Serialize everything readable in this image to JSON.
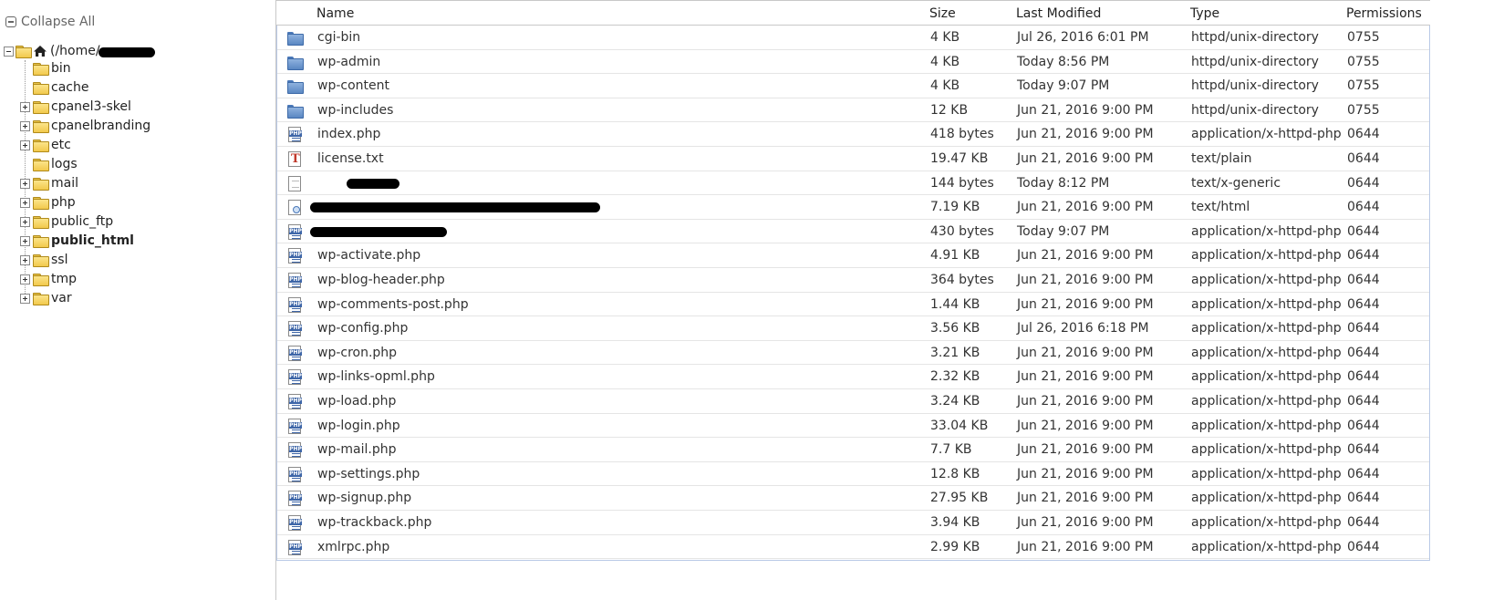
{
  "tree": {
    "collapse_all_label": "Collapse All",
    "root_label": "(/home/",
    "items": [
      {
        "label": "bin",
        "expandable": false,
        "bold": false
      },
      {
        "label": "cache",
        "expandable": false,
        "bold": false
      },
      {
        "label": "cpanel3-skel",
        "expandable": true,
        "bold": false
      },
      {
        "label": "cpanelbranding",
        "expandable": true,
        "bold": false
      },
      {
        "label": "etc",
        "expandable": true,
        "bold": false
      },
      {
        "label": "logs",
        "expandable": false,
        "bold": false
      },
      {
        "label": "mail",
        "expandable": true,
        "bold": false
      },
      {
        "label": "php",
        "expandable": true,
        "bold": false
      },
      {
        "label": "public_ftp",
        "expandable": true,
        "bold": false
      },
      {
        "label": "public_html",
        "expandable": true,
        "bold": true
      },
      {
        "label": "ssl",
        "expandable": true,
        "bold": false
      },
      {
        "label": "tmp",
        "expandable": true,
        "bold": false
      },
      {
        "label": "var",
        "expandable": true,
        "bold": false
      }
    ]
  },
  "file_table": {
    "columns": {
      "name": "Name",
      "size": "Size",
      "modified": "Last Modified",
      "type": "Type",
      "permissions": "Permissions"
    },
    "rows": [
      {
        "icon": "folder-icon",
        "name": "cgi-bin",
        "size": "4 KB",
        "modified": "Jul 26, 2016 6:01 PM",
        "type": "httpd/unix-directory",
        "perm": "0755"
      },
      {
        "icon": "folder-icon",
        "name": "wp-admin",
        "size": "4 KB",
        "modified": "Today 8:56 PM",
        "type": "httpd/unix-directory",
        "perm": "0755"
      },
      {
        "icon": "folder-icon",
        "name": "wp-content",
        "size": "4 KB",
        "modified": "Today 9:07 PM",
        "type": "httpd/unix-directory",
        "perm": "0755"
      },
      {
        "icon": "folder-icon",
        "name": "wp-includes",
        "size": "12 KB",
        "modified": "Jun 21, 2016 9:00 PM",
        "type": "httpd/unix-directory",
        "perm": "0755"
      },
      {
        "icon": "php-file-icon",
        "name": "index.php",
        "size": "418 bytes",
        "modified": "Jun 21, 2016 9:00 PM",
        "type": "application/x-httpd-php",
        "perm": "0644"
      },
      {
        "icon": "text-file-icon",
        "name": "license.txt",
        "size": "19.47 KB",
        "modified": "Jun 21, 2016 9:00 PM",
        "type": "text/plain",
        "perm": "0644"
      },
      {
        "icon": "generic-file-icon",
        "name": "",
        "redacted": true,
        "size": "144 bytes",
        "modified": "Today 8:12 PM",
        "type": "text/x-generic",
        "perm": "0644"
      },
      {
        "icon": "html-file-icon",
        "name": "",
        "redacted": true,
        "size": "7.19 KB",
        "modified": "Jun 21, 2016 9:00 PM",
        "type": "text/html",
        "perm": "0644"
      },
      {
        "icon": "php-file-icon",
        "name": "",
        "redacted": true,
        "size": "430 bytes",
        "modified": "Today 9:07 PM",
        "type": "application/x-httpd-php",
        "perm": "0644"
      },
      {
        "icon": "php-file-icon",
        "name": "wp-activate.php",
        "size": "4.91 KB",
        "modified": "Jun 21, 2016 9:00 PM",
        "type": "application/x-httpd-php",
        "perm": "0644"
      },
      {
        "icon": "php-file-icon",
        "name": "wp-blog-header.php",
        "size": "364 bytes",
        "modified": "Jun 21, 2016 9:00 PM",
        "type": "application/x-httpd-php",
        "perm": "0644"
      },
      {
        "icon": "php-file-icon",
        "name": "wp-comments-post.php",
        "size": "1.44 KB",
        "modified": "Jun 21, 2016 9:00 PM",
        "type": "application/x-httpd-php",
        "perm": "0644"
      },
      {
        "icon": "php-file-icon",
        "name": "wp-config.php",
        "size": "3.56 KB",
        "modified": "Jul 26, 2016 6:18 PM",
        "type": "application/x-httpd-php",
        "perm": "0644"
      },
      {
        "icon": "php-file-icon",
        "name": "wp-cron.php",
        "size": "3.21 KB",
        "modified": "Jun 21, 2016 9:00 PM",
        "type": "application/x-httpd-php",
        "perm": "0644"
      },
      {
        "icon": "php-file-icon",
        "name": "wp-links-opml.php",
        "size": "2.32 KB",
        "modified": "Jun 21, 2016 9:00 PM",
        "type": "application/x-httpd-php",
        "perm": "0644"
      },
      {
        "icon": "php-file-icon",
        "name": "wp-load.php",
        "size": "3.24 KB",
        "modified": "Jun 21, 2016 9:00 PM",
        "type": "application/x-httpd-php",
        "perm": "0644"
      },
      {
        "icon": "php-file-icon",
        "name": "wp-login.php",
        "size": "33.04 KB",
        "modified": "Jun 21, 2016 9:00 PM",
        "type": "application/x-httpd-php",
        "perm": "0644"
      },
      {
        "icon": "php-file-icon",
        "name": "wp-mail.php",
        "size": "7.7 KB",
        "modified": "Jun 21, 2016 9:00 PM",
        "type": "application/x-httpd-php",
        "perm": "0644"
      },
      {
        "icon": "php-file-icon",
        "name": "wp-settings.php",
        "size": "12.8 KB",
        "modified": "Jun 21, 2016 9:00 PM",
        "type": "application/x-httpd-php",
        "perm": "0644"
      },
      {
        "icon": "php-file-icon",
        "name": "wp-signup.php",
        "size": "27.95 KB",
        "modified": "Jun 21, 2016 9:00 PM",
        "type": "application/x-httpd-php",
        "perm": "0644"
      },
      {
        "icon": "php-file-icon",
        "name": "wp-trackback.php",
        "size": "3.94 KB",
        "modified": "Jun 21, 2016 9:00 PM",
        "type": "application/x-httpd-php",
        "perm": "0644"
      },
      {
        "icon": "php-file-icon",
        "name": "xmlrpc.php",
        "size": "2.99 KB",
        "modified": "Jun 21, 2016 9:00 PM",
        "type": "application/x-httpd-php",
        "perm": "0644"
      }
    ]
  },
  "colors": {
    "list_border": "#b9c9e6",
    "folder_yellow": "#f2c94c",
    "folder_blue": "#5a87c2",
    "php_blue": "#3e66a8"
  }
}
